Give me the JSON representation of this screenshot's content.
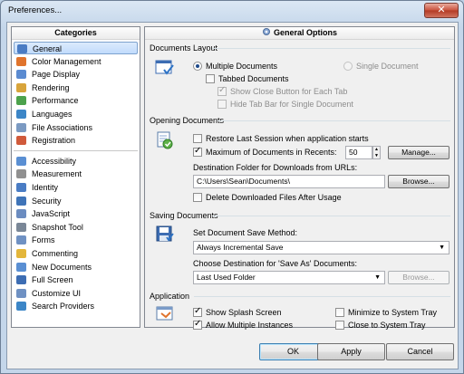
{
  "window": {
    "title": "Preferences...",
    "close": "✕"
  },
  "sidebar": {
    "header": "Categories",
    "group1": [
      {
        "label": "General",
        "color": "#4a7cc4",
        "selected": true
      },
      {
        "label": "Color Management",
        "color": "#e0742d"
      },
      {
        "label": "Page Display",
        "color": "#5b8bd1"
      },
      {
        "label": "Rendering",
        "color": "#d8a43b"
      },
      {
        "label": "Performance",
        "color": "#4ca24c"
      },
      {
        "label": "Languages",
        "color": "#3c86c7"
      },
      {
        "label": "File Associations",
        "color": "#7b9ac2"
      },
      {
        "label": "Registration",
        "color": "#d05a3b"
      }
    ],
    "group2": [
      {
        "label": "Accessibility",
        "color": "#5a8fd3"
      },
      {
        "label": "Measurement",
        "color": "#909090"
      },
      {
        "label": "Identity",
        "color": "#4a7cc4"
      },
      {
        "label": "Security",
        "color": "#3f74b8"
      },
      {
        "label": "JavaScript",
        "color": "#6b8cc0"
      },
      {
        "label": "Snapshot Tool",
        "color": "#7a8797"
      },
      {
        "label": "Forms",
        "color": "#6f91c3"
      },
      {
        "label": "Commenting",
        "color": "#e3b63b"
      },
      {
        "label": "New Documents",
        "color": "#5a8fd3"
      },
      {
        "label": "Full Screen",
        "color": "#3d6db3"
      },
      {
        "label": "Customize UI",
        "color": "#6f91c3"
      },
      {
        "label": "Search Providers",
        "color": "#3c86c7"
      }
    ]
  },
  "main": {
    "header": "General Options",
    "documents_layout": {
      "title": "Documents Layout",
      "multiple": "Multiple Documents",
      "single": "Single Document",
      "tabbed": "Tabbed Documents",
      "show_close": "Show Close Button for Each Tab",
      "hide_tab": "Hide Tab Bar for Single Document"
    },
    "opening": {
      "title": "Opening Documents",
      "restore": "Restore Last Session when application starts",
      "maximum": "Maximum of Documents in Recents:",
      "maximum_value": "50",
      "manage": "Manage...",
      "destination_label": "Destination Folder for Downloads from URLs:",
      "destination_value": "C:\\Users\\Sean\\Documents\\",
      "browse": "Browse...",
      "delete": "Delete Downloaded Files After Usage"
    },
    "saving": {
      "title": "Saving Documents",
      "method_label": "Set Document Save Method:",
      "method_value": "Always Incremental Save",
      "dest_label": "Choose Destination for 'Save As' Documents:",
      "dest_value": "Last Used Folder",
      "browse": "Browse..."
    },
    "application": {
      "title": "Application",
      "splash": "Show Splash Screen",
      "multiple": "Allow Multiple Instances",
      "minimize": "Minimize to System Tray",
      "close": "Close to System Tray"
    }
  },
  "footer": {
    "ok": "OK",
    "apply": "Apply",
    "cancel": "Cancel"
  }
}
